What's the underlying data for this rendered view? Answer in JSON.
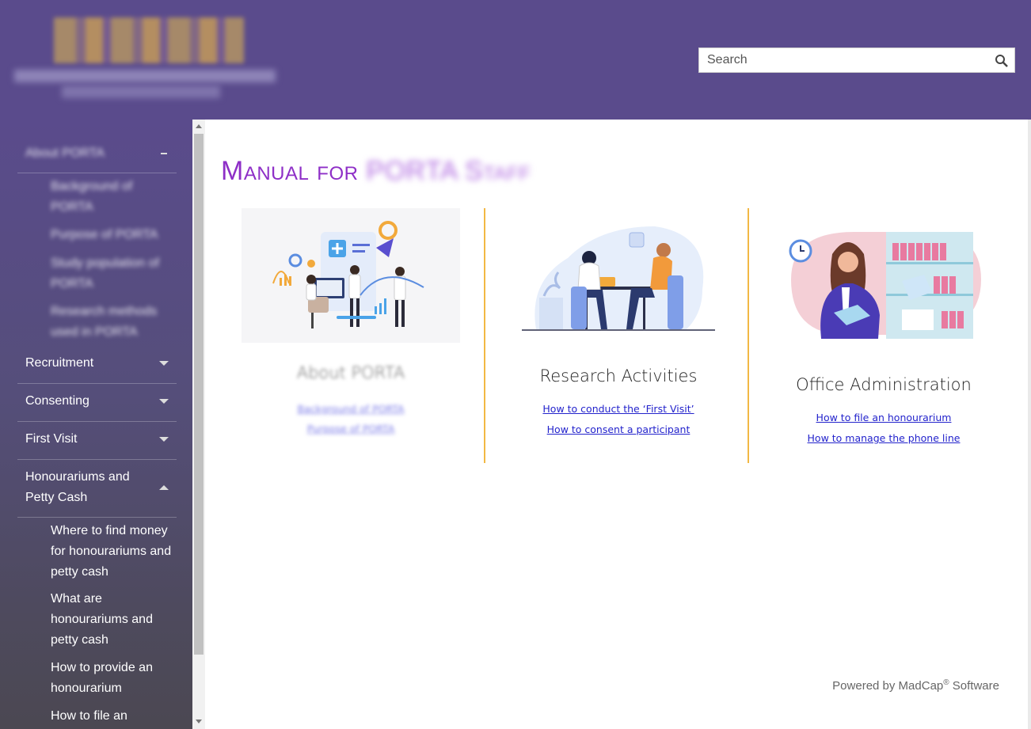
{
  "search": {
    "placeholder": "Search"
  },
  "sidebar": {
    "top_item": {
      "label": "About PORTA"
    },
    "top_subitems": [
      "Background of PORTA",
      "Purpose of PORTA",
      "Study population of PORTA",
      "Research methods used in PORTA"
    ],
    "items": [
      {
        "label": "Recruitment"
      },
      {
        "label": "Consenting"
      },
      {
        "label": "First Visit"
      },
      {
        "label": "Honourariums and Petty Cash"
      }
    ],
    "subitems": [
      "Where to find money for honourariums and petty cash",
      "What are honourariums and petty cash",
      "How to provide an honourarium",
      "How to file an"
    ]
  },
  "main": {
    "title_prefix": "Manual for",
    "title_blurred": "PORTA Staff",
    "cards": [
      {
        "heading": "About PORTA",
        "links": [
          "Background of PORTA",
          "Purpose of PORTA"
        ]
      },
      {
        "heading": "Research Activities",
        "links": [
          "How to conduct the ‘First Visit’",
          "How to consent a participant"
        ]
      },
      {
        "heading": "Office Administration",
        "links": [
          "How to file an honourarium",
          "How to manage the phone line"
        ]
      }
    ],
    "footer_prefix": "Powered by MadCap",
    "footer_reg": "®",
    "footer_suffix": " Software"
  },
  "colors": {
    "header": "#5a4b8c",
    "title": "#8e2fc7",
    "divider": "#f2b844",
    "link": "#2323cc"
  }
}
